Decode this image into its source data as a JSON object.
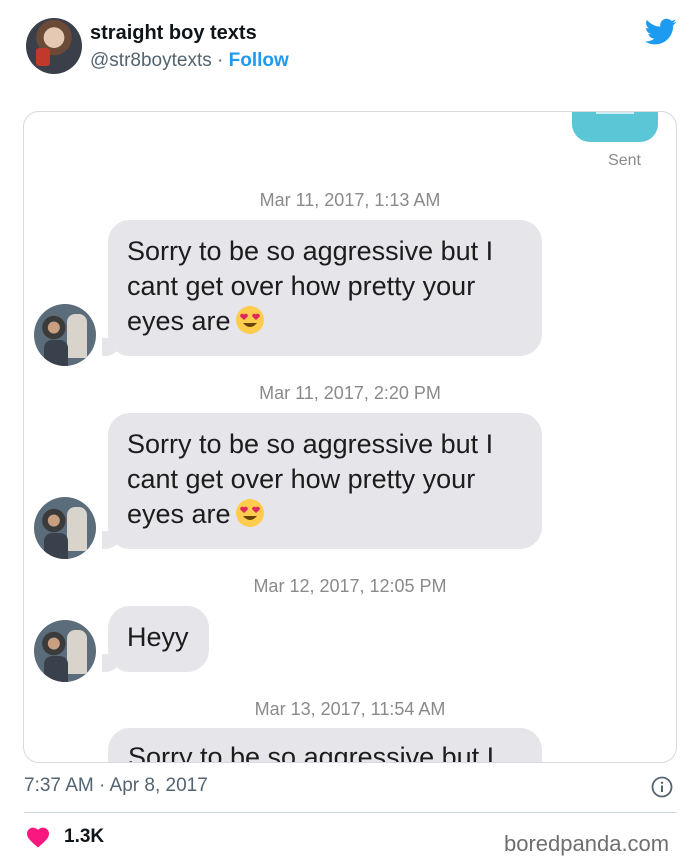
{
  "tweet": {
    "display_name": "straight boy texts",
    "handle": "@str8boytexts",
    "separator": " · ",
    "follow_label": "Follow",
    "timestamp": "7:37 AM · Apr 8, 2017",
    "likes": "1.3K",
    "watermark": "boredpanda.com"
  },
  "conversation": {
    "sent_label": "Sent",
    "messages": [
      {
        "time": "Mar 11, 2017, 1:13 AM",
        "text": "Sorry to be so aggressive but I cant get over how pretty your eyes are"
      },
      {
        "time": "Mar 11, 2017, 2:20 PM",
        "text": "Sorry to be so aggressive but I cant get over how pretty your eyes are"
      },
      {
        "time": "Mar 12, 2017, 12:05 PM",
        "text": "Heyy"
      },
      {
        "time": "Mar 13, 2017, 11:54 AM",
        "text": "Sorry to be so aggressive but I"
      }
    ]
  },
  "colors": {
    "brand": "#1d9bf0",
    "like": "#f91880",
    "bubble_received": "#e5e5ea",
    "bubble_sent": "#5bc6d6"
  },
  "icons": [
    "twitter-bird-icon",
    "heart-eyes-emoji",
    "info-icon",
    "heart-icon"
  ]
}
